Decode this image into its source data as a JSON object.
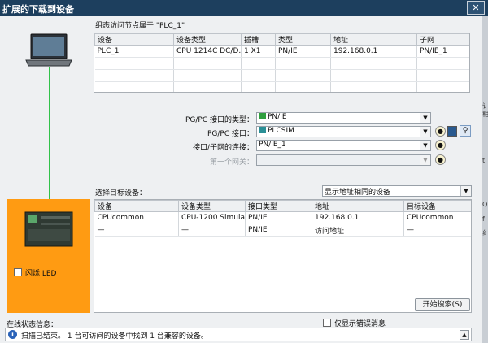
{
  "window": {
    "title": "扩展的下载到设备",
    "close_symbol": "✕"
  },
  "accessible_nodes": {
    "caption": "组态访问节点属于 \"PLC_1\"",
    "columns": [
      "设备",
      "设备类型",
      "插槽",
      "类型",
      "地址",
      "子网"
    ],
    "rows": [
      [
        "PLC_1",
        "CPU 1214C DC/D...",
        "1 X1",
        "PN/IE",
        "192.168.0.1",
        "PN/IE_1"
      ]
    ]
  },
  "interface": {
    "type_label": "PG/PC 接口的类型：",
    "type_value": "PN/IE",
    "port_label": "PG/PC 接口：",
    "port_value": "PLCSIM",
    "subnet_label": "接口/子网的连接：",
    "subnet_value": "PN/IE_1",
    "gateway_label": "第一个网关：",
    "gateway_value": ""
  },
  "target": {
    "label": "选择目标设备：",
    "filter_value": "显示地址相同的设备",
    "columns": [
      "设备",
      "设备类型",
      "接口类型",
      "地址",
      "目标设备"
    ],
    "rows": [
      [
        "CPUcommon",
        "CPU-1200 Simula...",
        "PN/IE",
        "192.168.0.1",
        "CPUcommon"
      ],
      [
        "—",
        "—",
        "PN/IE",
        "访问地址",
        "—"
      ]
    ]
  },
  "flash_led_label": "闪烁 LED",
  "start_search_label": "开始搜索(S)",
  "status": {
    "label": "在线状态信息：",
    "only_errors_label": "仅显示错误消息",
    "message": "扫描已结束。 1 台可访问的设备中找到 1 台兼容的设备。",
    "info_symbol": "i"
  },
  "right_edge_glyphs": [
    "讠",
    "相",
    "t",
    "Q",
    "f",
    "纟"
  ],
  "colors": {
    "titlebar": "#1d3f5e",
    "device_panel": "#ff9b12",
    "link_line": "#31c24a",
    "selection": "#cfd8e6"
  }
}
